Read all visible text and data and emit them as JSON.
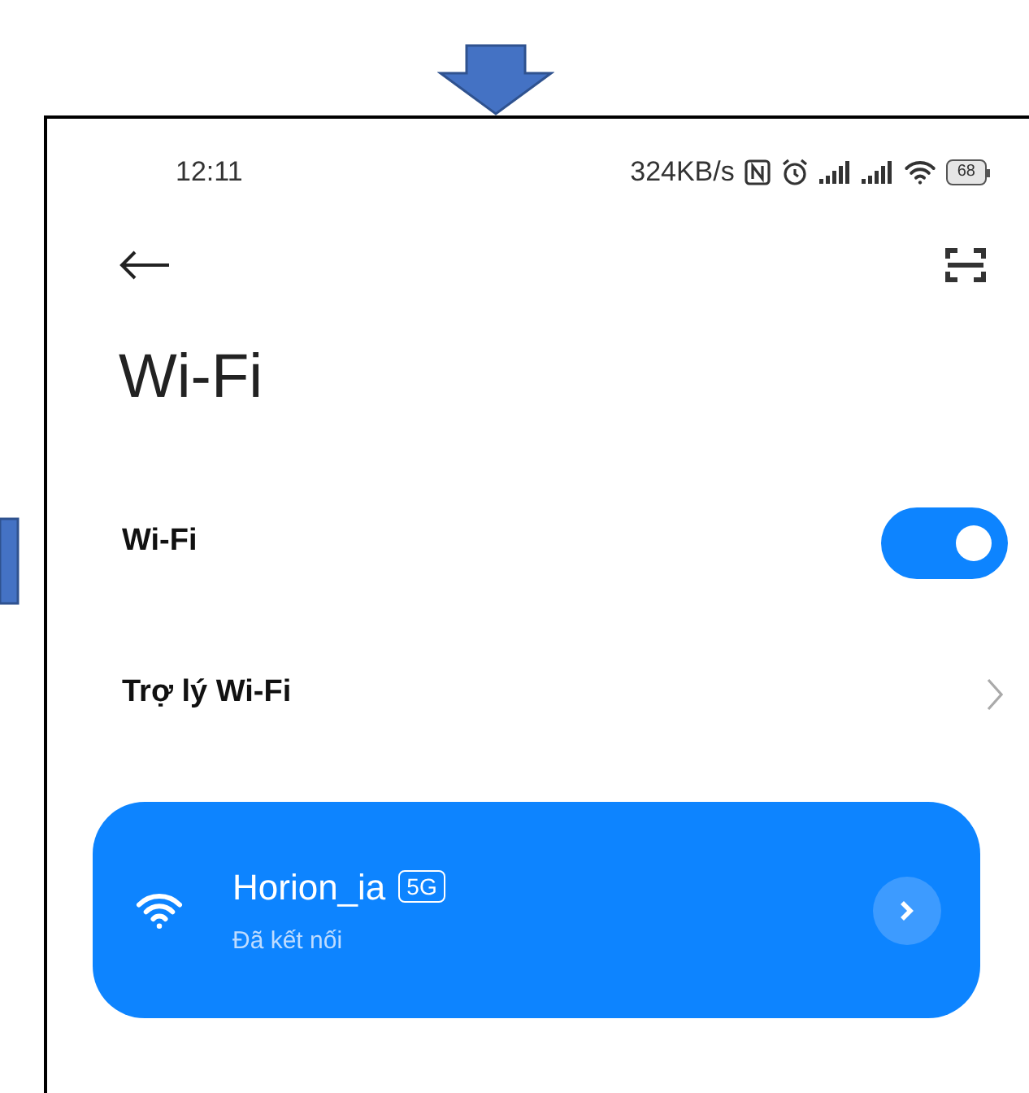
{
  "status_bar": {
    "time": "12:11",
    "speed": "324KB/s",
    "battery": "68"
  },
  "title": "Wi-Fi",
  "wifi_toggle": {
    "label": "Wi-Fi",
    "on": true
  },
  "assistant": {
    "label": "Trợ lý Wi-Fi"
  },
  "connected_network": {
    "name": "Horion_ia",
    "band": "5G",
    "status": "Đã kết nối",
    "selected": true
  }
}
